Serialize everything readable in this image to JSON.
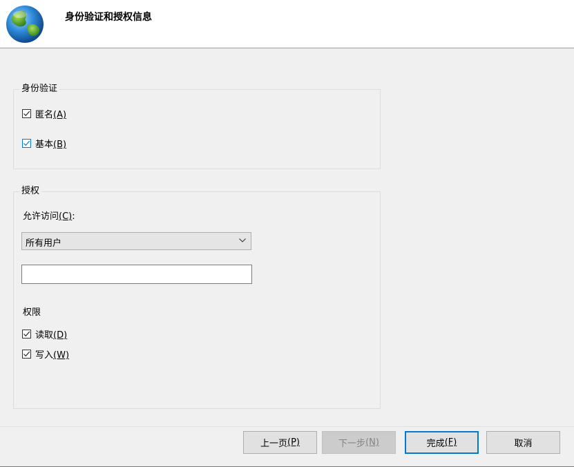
{
  "header": {
    "title": "身份验证和授权信息",
    "icon": "globe-icon"
  },
  "authentication": {
    "title": "身份验证",
    "anonymous": {
      "label": "匿名",
      "accel": "(A)",
      "checked": true
    },
    "basic": {
      "label": "基本",
      "accel": "(B)",
      "checked": true
    }
  },
  "authorization": {
    "title": "授权",
    "allow_access_label": "允许访问",
    "allow_access_accel": "(C)",
    "allow_access_colon": ":",
    "allow_access_value": "所有用户",
    "users_input_value": "",
    "permissions_title": "权限",
    "read": {
      "label": "读取",
      "accel": "(D)",
      "checked": true
    },
    "write": {
      "label": "写入",
      "accel": "(W)",
      "checked": true
    }
  },
  "buttons": {
    "previous": {
      "label": "上一页",
      "accel": "(P)"
    },
    "next": {
      "label": "下一步",
      "accel": "(N)"
    },
    "finish": {
      "label": "完成",
      "accel": "(F)"
    },
    "cancel": "取消"
  },
  "colors": {
    "accent": "#0078d7",
    "background": "#f0f0f0"
  }
}
